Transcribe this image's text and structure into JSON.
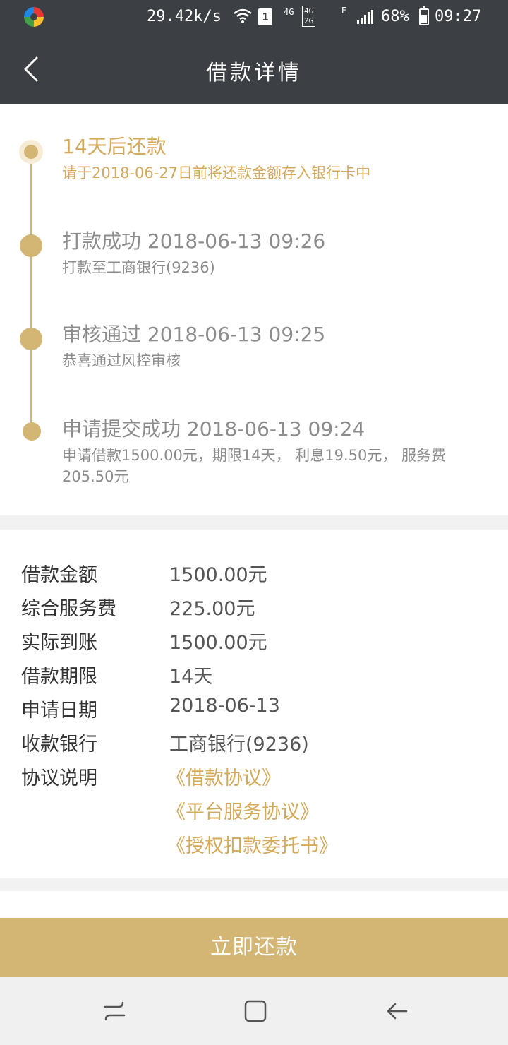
{
  "status_bar": {
    "speed": "29.42k/s",
    "sim": "1",
    "network_4g": "4G",
    "network_4g2g_top": "4G",
    "network_4g2g_bottom": "2G",
    "network_e": "E",
    "battery": "68%",
    "time": "09:27"
  },
  "header": {
    "title": "借款详情",
    "back_icon": "chevron-left-icon"
  },
  "timeline": [
    {
      "title": "14天后还款",
      "subtitle": "请于2018-06-27日前将还款金额存入银行卡中",
      "active": true
    },
    {
      "title": "打款成功 2018-06-13 09:26",
      "subtitle": "打款至工商银行(9236)",
      "active": false
    },
    {
      "title": "审核通过 2018-06-13 09:25",
      "subtitle": "恭喜通过风控审核",
      "active": false
    },
    {
      "title": "申请提交成功 2018-06-13 09:24",
      "subtitle": "申请借款1500.00元，期限14天， 利息19.50元， 服务费205.50元",
      "active": false
    }
  ],
  "details": [
    {
      "label": "借款金额",
      "value": "1500.00元"
    },
    {
      "label": "综合服务费",
      "value": "225.00元"
    },
    {
      "label": "实际到账",
      "value": "1500.00元"
    },
    {
      "label": "借款期限",
      "value": "14天"
    },
    {
      "label": "申请日期",
      "value": "2018-06-13"
    },
    {
      "label": "收款银行",
      "value": "工商银行(9236)"
    }
  ],
  "agreements": {
    "label": "协议说明",
    "links": [
      "《借款协议》",
      "《平台服务协议》",
      "《授权扣款委托书》"
    ]
  },
  "repay_button": "立即还款",
  "colors": {
    "header_bg": "#3c4045",
    "accent_gold": "#d4b674",
    "link_gold": "#d4a959",
    "text_gray": "#8c8c8c"
  }
}
